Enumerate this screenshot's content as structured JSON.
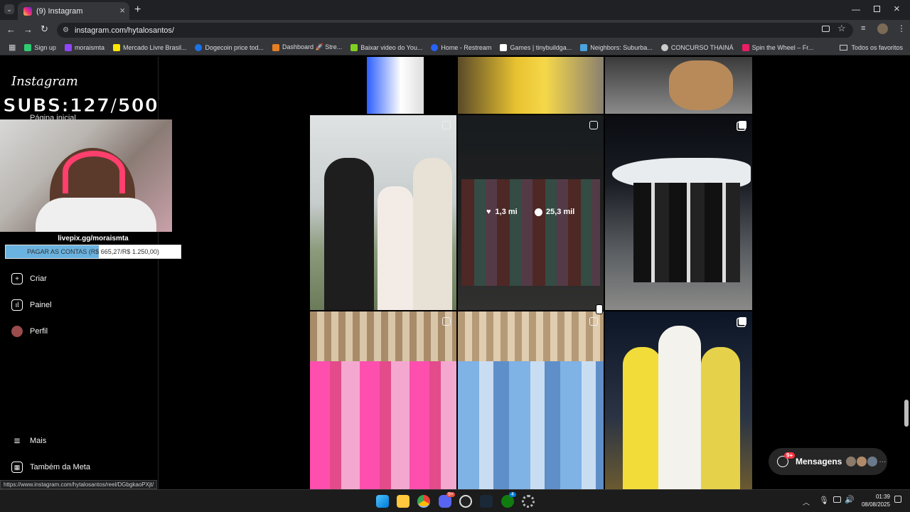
{
  "browser": {
    "tab_title": "(9) Instagram",
    "url": "instagram.com/hytalosantos/",
    "status_url": "https://www.instagram.com/hytalosantos/reel/DGbgkaoPXjt/",
    "bookmarks": [
      "Sign up",
      "moraismta",
      "Mercado Livre Brasil...",
      "Dogecoin price tod...",
      "Dashboard 🚀 Stre...",
      "Baixar video do You...",
      "Home - Restream",
      "Games | tinybuildga...",
      "Neighbors: Suburba...",
      "CONCURSO THAINÁ",
      "Spin the Wheel – Fr..."
    ],
    "all_bookmarks": "Todos os favoritos"
  },
  "sidebar": {
    "logo": "Instagram",
    "home_partial": "Página inicial",
    "items": [
      {
        "label": "Criar"
      },
      {
        "label": "Painel"
      },
      {
        "label": "Perfil"
      },
      {
        "label": "Mais"
      },
      {
        "label": "Também da Meta"
      }
    ]
  },
  "overlay": {
    "subs": "SUBS:127/500",
    "pix_url": "livepix.gg/moraismta",
    "goal_text": "PAGAR AS CONTAS (R$ 665,27/R$ 1.250,00)",
    "goal_progress": 0.532
  },
  "grid": {
    "hover_likes": "1,3 mi",
    "hover_comments": "25,3 mil"
  },
  "messages": {
    "label": "Mensagens",
    "badge": "9+"
  },
  "taskbar": {
    "time": "01:39",
    "date": "08/08/2025",
    "discord_badge": "9+",
    "xbox_badge": "4"
  }
}
